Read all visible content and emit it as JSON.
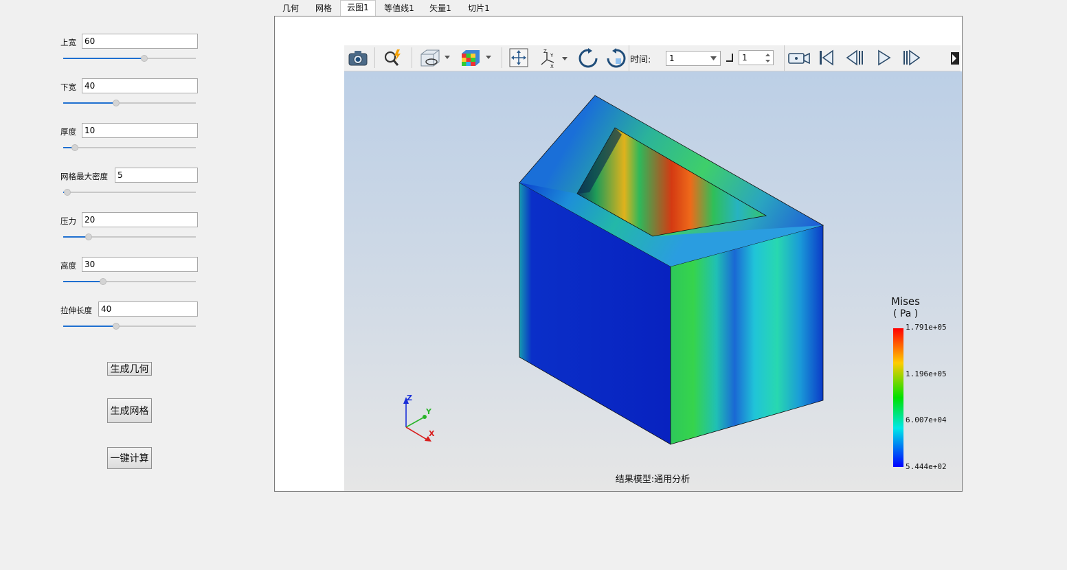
{
  "params": [
    {
      "label": "上宽",
      "value": "60",
      "fraction": 0.61
    },
    {
      "label": "下宽",
      "value": "40",
      "fraction": 0.4
    },
    {
      "label": "厚度",
      "value": "10",
      "fraction": 0.09
    },
    {
      "label": "网格最大密度",
      "value": "5",
      "fraction": 0.03
    },
    {
      "label": "压力",
      "value": "20",
      "fraction": 0.19
    },
    {
      "label": "高度",
      "value": "30",
      "fraction": 0.3
    },
    {
      "label": "拉伸长度",
      "value": "40",
      "fraction": 0.4
    }
  ],
  "buttons": {
    "generate_geometry": "生成几何",
    "generate_mesh": "生成网格",
    "one_click_compute": "一键计算"
  },
  "tabs": [
    "几何",
    "网格",
    "云图1",
    "等值线1",
    "矢量1",
    "切片1"
  ],
  "active_tab": "云图1",
  "toolbar": {
    "time_label": "时间:",
    "time_value": "1",
    "step_value": "1",
    "icons": [
      "camera-icon",
      "probe-icon",
      "display-mode-icon",
      "color-cube-icon",
      "fit-view-icon",
      "axes-orientation-icon",
      "rotate-ccw-icon",
      "rotate-cw-icon",
      "record-icon",
      "first-frame-icon",
      "prev-frame-icon",
      "play-icon",
      "next-frame-icon",
      "more-icon"
    ]
  },
  "legend": {
    "title": "Mises",
    "unit": "( Pa )",
    "max": "1.791e+05",
    "mid_high": "1.196e+05",
    "mid_low": "6.007e+04",
    "min": "5.444e+02",
    "colors": [
      "#ff0000",
      "#ffcc00",
      "#00e000",
      "#00e8e8",
      "#0000ff"
    ]
  },
  "axes": {
    "x": "X",
    "y": "Y",
    "z": "Z"
  },
  "caption": "结果模型:通用分析"
}
